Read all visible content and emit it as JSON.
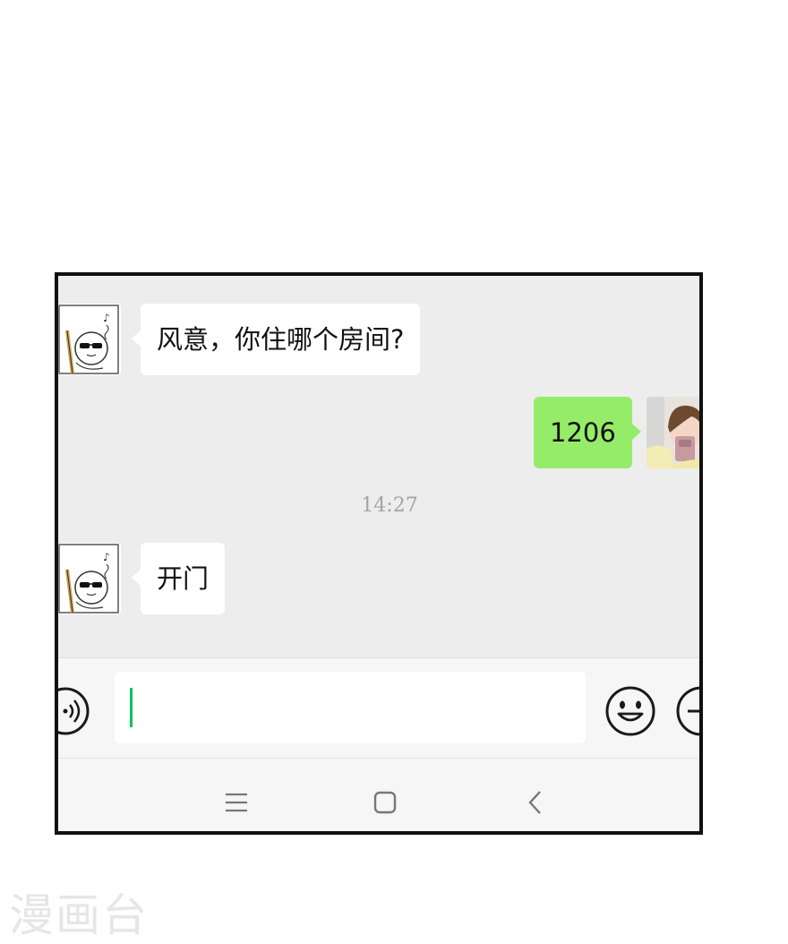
{
  "chat": {
    "messages": [
      {
        "sender": "contact",
        "text": "风意，你住哪个房间?"
      },
      {
        "sender": "self",
        "text": "1206"
      }
    ],
    "timestamp": "14:27",
    "messages_after": [
      {
        "sender": "contact",
        "text": "开门"
      }
    ]
  },
  "input_bar": {
    "value": "",
    "icons": [
      "voice-icon",
      "emoji-icon",
      "plus-icon"
    ]
  },
  "nav_bar": {
    "icons": [
      "menu-icon",
      "home-icon",
      "back-icon"
    ]
  },
  "watermark": "漫画台",
  "colors": {
    "self_bubble": "#95ec69",
    "contact_bubble": "#ffffff",
    "chat_background": "#ededed",
    "caret": "#07c160"
  }
}
